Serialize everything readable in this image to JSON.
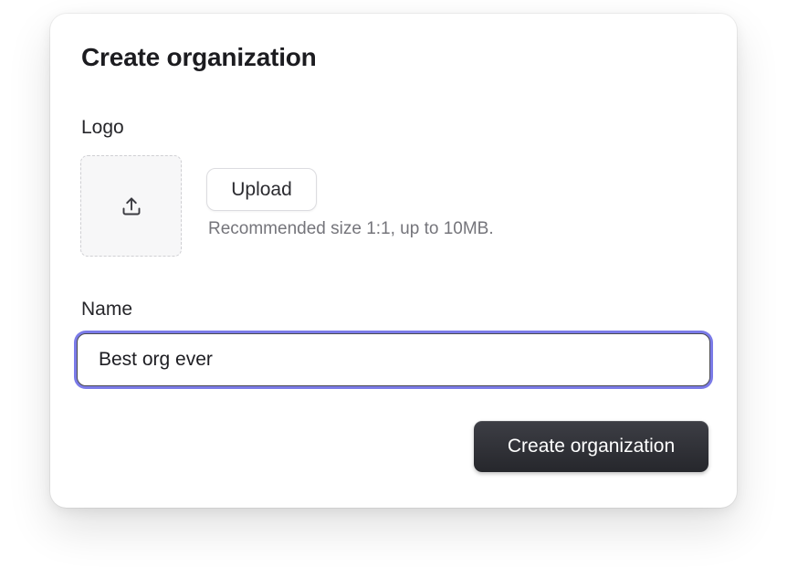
{
  "dialog": {
    "title": "Create organization",
    "logo": {
      "label": "Logo",
      "dropzone_icon": "upload-icon",
      "upload_button_label": "Upload",
      "hint": "Recommended size 1:1, up to 10MB."
    },
    "name": {
      "label": "Name",
      "value": "Best org ever",
      "focused": true
    },
    "submit_label": "Create organization"
  },
  "colors": {
    "focus_ring": "#7b7be8",
    "primary_button": "#2f3036",
    "dropzone_background": "#f7f7f8"
  }
}
